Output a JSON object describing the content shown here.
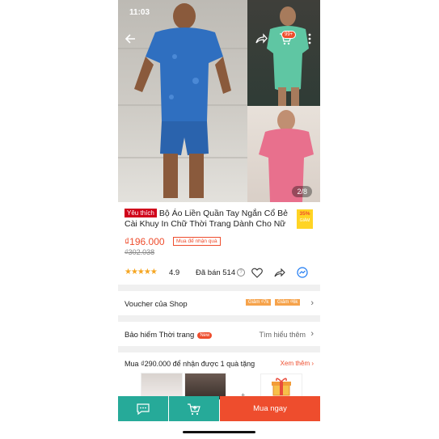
{
  "status_bar": {
    "time": "11:03"
  },
  "gallery": {
    "counter": "2/8",
    "cart_badge": "99+"
  },
  "product": {
    "favorite_tag": "Yêu thích",
    "title": "Bộ Áo Liền Quần Tay Ngắn Cổ Bẻ Cài Khuy In Chữ Thời Trang Dành Cho Nữ",
    "discount_percent": "35%",
    "discount_label": "GIẢM",
    "price": "₫196.000",
    "promo_chip": "Mua để nhận quà",
    "old_price": "₫302.038",
    "stars": "★★★★★",
    "rating": "4.9",
    "sold": "Đã bán 514",
    "info_symbol": "?"
  },
  "voucher": {
    "label": "Voucher của Shop",
    "chips": [
      "Giảm ₫7k",
      "Giảm ₫6k"
    ],
    "chevron": "›"
  },
  "insurance": {
    "label": "Bảo hiểm Thời trang",
    "new_badge": "New",
    "link": "Tìm hiểu thêm",
    "chevron": "›"
  },
  "gift": {
    "label": "Mua ₫290.000 để nhận được 1 quà tặng",
    "more": "Xem thêm ›",
    "plus": "+"
  },
  "bottom_bar": {
    "buy_label": "Mua ngay"
  },
  "colors": {
    "brand": "#ee4d2d",
    "teal": "#26aa99",
    "star": "#f5a623",
    "voucher_chip": "#f6a34b",
    "discount_bg": "#ffd424"
  },
  "icons": [
    "back-arrow-icon",
    "share-icon",
    "cart-icon",
    "more-icon",
    "heart-icon",
    "share-icon",
    "messenger-icon",
    "info-icon",
    "chevron-right-icon",
    "chat-icon",
    "add-to-cart-icon",
    "gift-box-icon"
  ]
}
